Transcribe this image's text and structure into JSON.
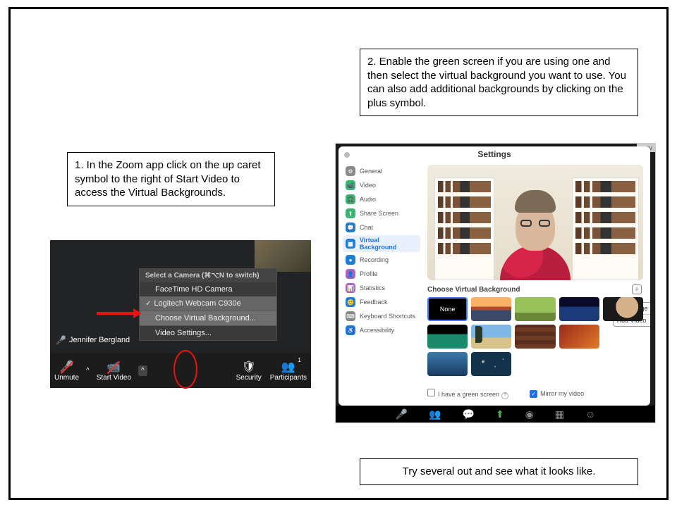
{
  "steps": {
    "s1": "1. In the Zoom app click on the up caret symbol to the right of Start Video to access the Virtual Backgrounds.",
    "s2": "2. Enable the green screen if you are using one and then select the virtual background you want to use. You can also add additional backgrounds by clicking on the plus symbol.",
    "s3": "Try several out and see what it looks like."
  },
  "zoom_menu": {
    "header": "Select a Camera (⌘⌥N to switch)",
    "items": [
      "FaceTime HD Camera",
      "Logitech Webcam C930e",
      "Choose Virtual Background...",
      "Video Settings..."
    ],
    "selected_index": 1
  },
  "toolbar": {
    "presenter": "Jennifer Bergland",
    "unmute": "Unmute",
    "start_video": "Start Video",
    "security": "Security",
    "participants": "Participants",
    "participants_count": "1"
  },
  "settings": {
    "title": "Settings",
    "preview_tag": "prev",
    "sidebar": {
      "items": [
        {
          "label": "General",
          "color": "#8a8a8a",
          "glyph": "⚙"
        },
        {
          "label": "Video",
          "color": "#3cb371",
          "glyph": "📹"
        },
        {
          "label": "Audio",
          "color": "#3cb371",
          "glyph": "🎧"
        },
        {
          "label": "Share Screen",
          "color": "#3cb371",
          "glyph": "⬆"
        },
        {
          "label": "Chat",
          "color": "#1e7fd6",
          "glyph": "💬"
        },
        {
          "label": "Virtual Background",
          "color": "#1e7fd6",
          "glyph": "▦",
          "active": true
        },
        {
          "label": "Recording",
          "color": "#1e7fd6",
          "glyph": "●"
        },
        {
          "label": "Profile",
          "color": "#b060c0",
          "glyph": "👤"
        },
        {
          "label": "Statistics",
          "color": "#b060c0",
          "glyph": "📊"
        },
        {
          "label": "Feedback",
          "color": "#1e7fd6",
          "glyph": "😊"
        },
        {
          "label": "Keyboard Shortcuts",
          "color": "#888888",
          "glyph": "⌨"
        },
        {
          "label": "Accessibility",
          "color": "#1e7fd6",
          "glyph": "♿"
        }
      ]
    },
    "section_title": "Choose Virtual Background",
    "none_label": "None",
    "plus": "+",
    "popover": {
      "add_image": "Add Image",
      "add_video": "Add Video"
    },
    "checks": {
      "green_screen": "I have a green screen",
      "mirror": "Mirror my video"
    }
  }
}
